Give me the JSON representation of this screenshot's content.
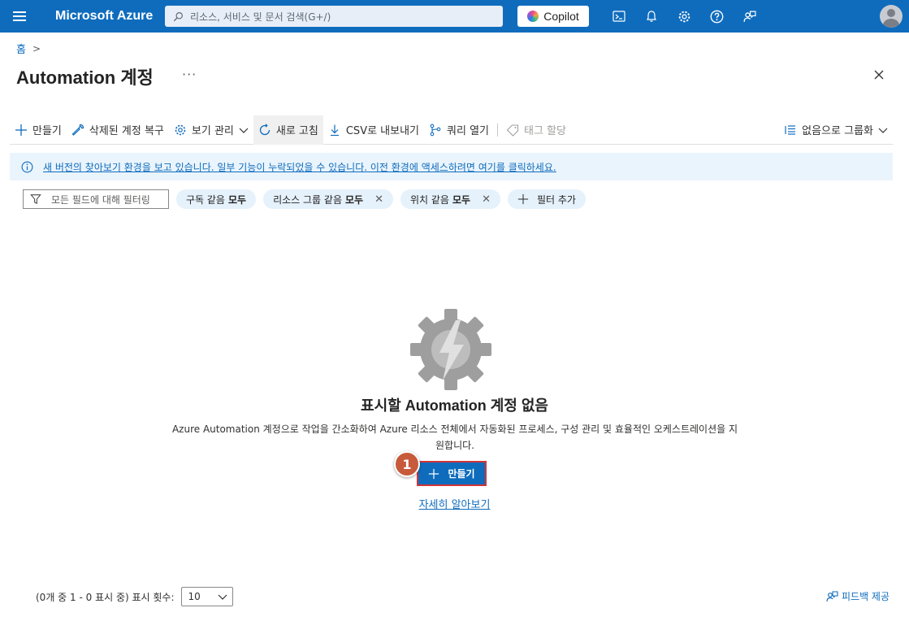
{
  "topbar": {
    "brand": "Microsoft Azure",
    "search_placeholder": "리소스, 서비스 및 문서 검색(G+/)",
    "copilot_label": "Copilot",
    "icons": [
      "cloud-shell-icon",
      "bell-icon",
      "gear-icon",
      "help-icon",
      "feedback-icon"
    ]
  },
  "breadcrumb": {
    "home": "홈",
    "sep": ">"
  },
  "page": {
    "title": "Automation 계정",
    "more": "···"
  },
  "commands": {
    "create": "만들기",
    "restore": "삭제된 계정 복구",
    "manage_view": "보기 관리",
    "refresh": "새로 고침",
    "export_csv": "CSV로 내보내기",
    "open_query": "쿼리 열기",
    "assign_tags": "태그 할당",
    "group_by": "없음으로 그룹화"
  },
  "info": {
    "text": "새 버전의 찾아보기 환경을 보고 있습니다. 일부 기능이 누락되었을 수 있습니다. 이전 환경에 액세스하려면 여기를 클릭하세요."
  },
  "filters": {
    "placeholder": "모든 필드에 대해 필터링",
    "pills": [
      {
        "label": "구독 같음",
        "value": "모두",
        "removable": false
      },
      {
        "label": "리소스 그룹 같음",
        "value": "모두",
        "removable": true
      },
      {
        "label": "위치 같음",
        "value": "모두",
        "removable": true
      }
    ],
    "add_filter": "필터 추가"
  },
  "empty": {
    "title": "표시할 Automation 계정 없음",
    "description": "Azure Automation 계정으로 작업을 간소화하여 Azure 리소스 전체에서 자동화된 프로세스, 구성 관리 및 효율적인 오케스트레이션을 지원합니다.",
    "create_label": "만들기",
    "step_number": "1",
    "learn_more": "자세히 알아보기"
  },
  "footer": {
    "pager_text": "(0개 중 1 - 0 표시 중) 표시 횟수:",
    "page_size": "10",
    "feedback": "피드백 제공"
  },
  "colors": {
    "accent": "#0f6cbd",
    "highlight": "#d13438",
    "badge": "#c75a3a"
  }
}
